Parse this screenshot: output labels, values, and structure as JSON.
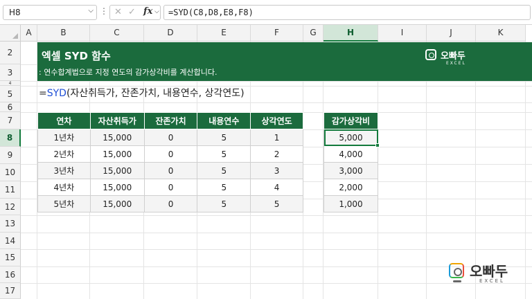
{
  "formula_bar": {
    "name_box": "H8",
    "cancel_glyph": "✕",
    "enter_glyph": "✓",
    "fx_label": "fx",
    "formula": "=SYD(C8,D8,E8,F8)"
  },
  "columns": [
    "A",
    "B",
    "C",
    "D",
    "E",
    "F",
    "G",
    "H",
    "I",
    "J",
    "K"
  ],
  "active_column": "H",
  "rows": [
    "2",
    "3",
    "4",
    "5",
    "6",
    "7",
    "8",
    "9",
    "10",
    "11",
    "12",
    "13",
    "14",
    "15",
    "16",
    "17"
  ],
  "active_row": "8",
  "banner": {
    "title": "엑셀 SYD 함수",
    "subtitle": ": 연수합계법으로 지정 연도의 감가상각비를 계산합니다.",
    "logo_text": "오빠두",
    "logo_sub": "EXCEL",
    "color": "#1b6b3d"
  },
  "syntax": {
    "prefix": "=",
    "function": "SYD",
    "args": "(자산취득가, 잔존가치, 내용연수, 상각연도)"
  },
  "input_table": {
    "headers": [
      "연차",
      "자산취득가",
      "잔존가치",
      "내용연수",
      "상각연도"
    ],
    "rows": [
      [
        "1년차",
        "15,000",
        "0",
        "5",
        "1"
      ],
      [
        "2년차",
        "15,000",
        "0",
        "5",
        "2"
      ],
      [
        "3년차",
        "15,000",
        "0",
        "5",
        "3"
      ],
      [
        "4년차",
        "15,000",
        "0",
        "5",
        "4"
      ],
      [
        "5년차",
        "15,000",
        "0",
        "5",
        "5"
      ]
    ]
  },
  "result_table": {
    "header": "감가상각비",
    "values": [
      "5,000",
      "4,000",
      "3,000",
      "2,000",
      "1,000"
    ],
    "selected_index": 0
  },
  "watermark": {
    "text": "오빠두",
    "sub": "EXCEL"
  },
  "icons": {
    "namebox_dropdown": "chevron-down-icon",
    "cancel": "close-icon",
    "enter": "check-icon",
    "insert_function": "fx-icon"
  }
}
